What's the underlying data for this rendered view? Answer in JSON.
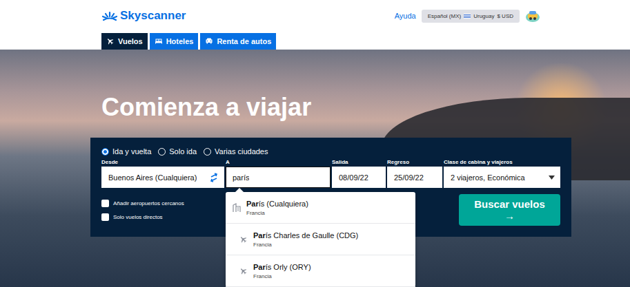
{
  "header": {
    "logo": "Skyscanner",
    "help": "Ayuda",
    "locale": {
      "language": "Español (MX)",
      "country": "Uruguay",
      "currency": "$ USD"
    }
  },
  "tabs": [
    {
      "label": "Vuelos",
      "kind": "flights",
      "selected": true
    },
    {
      "label": "Hoteles",
      "kind": "hotels",
      "selected": false
    },
    {
      "label": "Renta de autos",
      "kind": "cars",
      "selected": false
    }
  ],
  "hero": {
    "title": "Comienza a viajar"
  },
  "search": {
    "trip_types": [
      {
        "label": "Ida y vuelta",
        "selected": true
      },
      {
        "label": "Solo ida",
        "selected": false
      },
      {
        "label": "Varias ciudades",
        "selected": false
      }
    ],
    "fields": [
      {
        "label": "Desde",
        "value": "Buenos Aires (Cualquiera)",
        "kind": "origin",
        "focused": false
      },
      {
        "label": "A",
        "value": "parís",
        "kind": "destination",
        "focused": true
      },
      {
        "label": "Salida",
        "value": "08/09/22",
        "kind": "date",
        "focused": false
      },
      {
        "label": "Regreso",
        "value": "25/09/22",
        "kind": "date",
        "focused": false
      },
      {
        "label": "Clase de cabina y viajeros",
        "value": "2 viajeros, Económica",
        "kind": "cabin",
        "focused": false
      }
    ],
    "options": [
      {
        "label": "Añadir aeropuertos cercanos",
        "checked": false
      },
      {
        "label": "Solo vuelos directos",
        "checked": false
      }
    ],
    "submit": "Buscar vuelos →"
  },
  "suggestions": [
    {
      "match": "Par",
      "rest": "ís (Cualquiera)",
      "country": "Francia",
      "kind": "city"
    },
    {
      "match": "Par",
      "rest": "ís Charles de Gaulle (CDG)",
      "country": "Francia",
      "kind": "airport"
    },
    {
      "match": "Par",
      "rest": "ís Orly (ORY)",
      "country": "Francia",
      "kind": "airport"
    }
  ]
}
